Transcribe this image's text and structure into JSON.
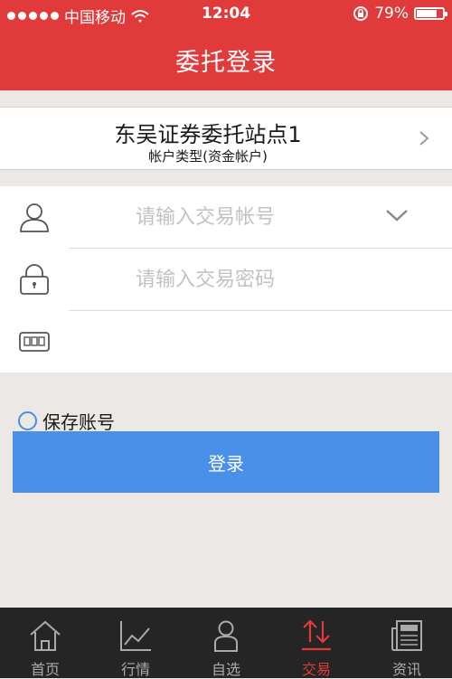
{
  "status_bar": {
    "carrier": "中国移动",
    "time": "12:04",
    "battery_percent": "79%",
    "battery_level": 0.79
  },
  "header": {
    "title": "委托登录"
  },
  "site_selector": {
    "name": "东吴证券委托站点1",
    "account_type": "帐户类型(资金帐户)"
  },
  "form": {
    "account_placeholder": "请输入交易帐号",
    "password_placeholder": "请输入交易密码",
    "captcha_placeholder": ""
  },
  "save_account": {
    "label": "保存账号",
    "checked": false
  },
  "login_button": {
    "label": "登录"
  },
  "tabbar": {
    "items": [
      {
        "label": "首页",
        "icon": "home-icon"
      },
      {
        "label": "行情",
        "icon": "chart-icon"
      },
      {
        "label": "自选",
        "icon": "person-icon"
      },
      {
        "label": "交易",
        "icon": "trade-arrows-icon",
        "active": true
      },
      {
        "label": "资讯",
        "icon": "news-icon"
      }
    ]
  },
  "colors": {
    "header_red": "#e03a3a",
    "button_blue": "#4a90e8",
    "tabbar_bg": "#252525",
    "page_bg": "#ebe8e6"
  }
}
